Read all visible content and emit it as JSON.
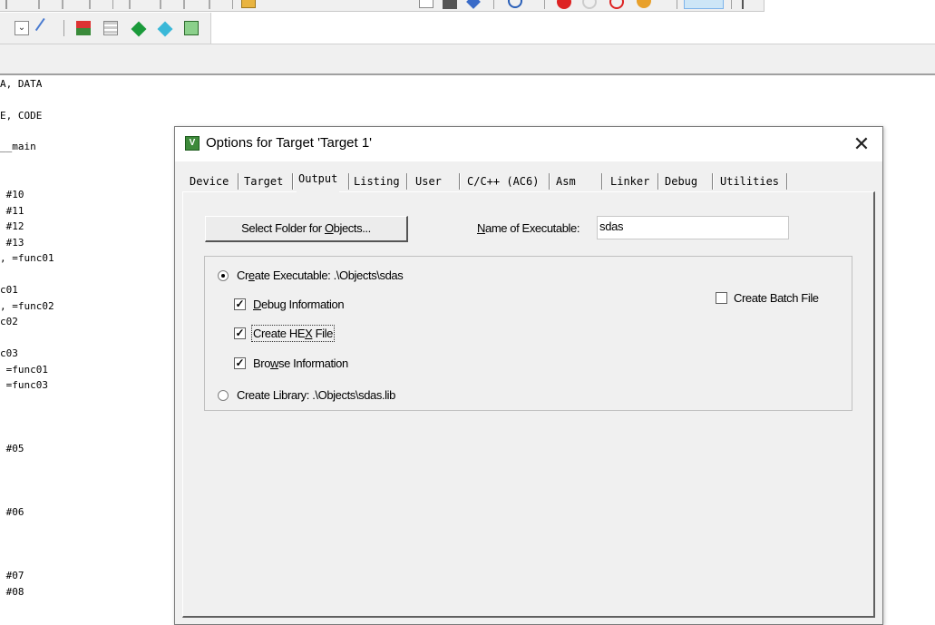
{
  "code_lines": [
    "A, DATA",
    "E, CODE",
    "__main",
    " #10",
    " #11",
    " #12",
    " #13",
    ", =func01",
    "c01",
    ", =func02",
    "c02",
    "c03",
    " =func01",
    " =func03",
    " #05",
    " #06",
    " #07",
    " #08"
  ],
  "dialog": {
    "title": "Options for Target 'Target 1'",
    "close_glyph": "✕",
    "tabs": [
      "Device",
      "Target",
      "Output",
      "Listing",
      "User",
      "C/C++ (AC6)",
      "Asm",
      "Linker",
      "Debug",
      "Utilities"
    ],
    "active_tab": "Output",
    "select_folder_button": {
      "before": "Select Folder for ",
      "accel": "O",
      "after": "bjects..."
    },
    "name_of_executable_label": {
      "accel": "N",
      "rest": "ame of Executable:"
    },
    "name_of_executable_value": "sdas",
    "create_executable": {
      "pre": "Cr",
      "accel": "e",
      "post": "ate Executable:  .\\Objects\\sdas",
      "checked": true
    },
    "debug_info": {
      "accel": "D",
      "rest": "ebug Information",
      "checked": true
    },
    "create_hex": {
      "pre": "Create HE",
      "accel": "X",
      "post": " File",
      "checked": true
    },
    "browse_info": {
      "pre": "Bro",
      "accel": "w",
      "post": "se Information",
      "checked": true
    },
    "create_batch": {
      "label": "Create Batch File",
      "checked": false
    },
    "create_library": {
      "label": "Create Library:  .\\Objects\\sdas.lib",
      "checked": false
    }
  },
  "colors": {
    "dialog_bg": "#f0f0f0",
    "title_bg": "#ffffff",
    "keil_icon": "#3d8a3a"
  }
}
